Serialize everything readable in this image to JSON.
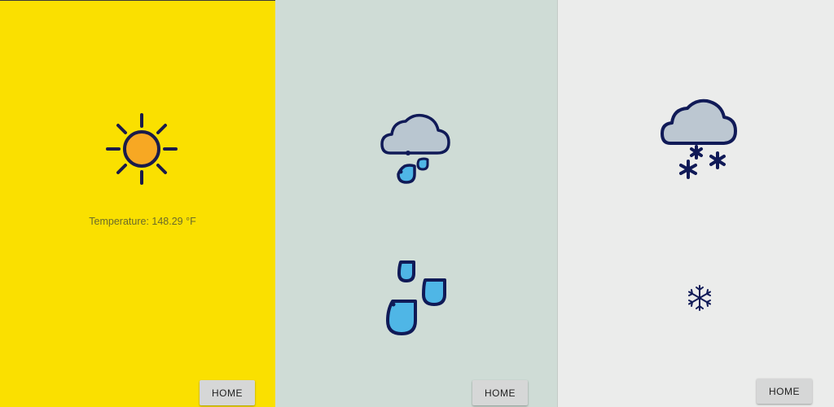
{
  "panels": {
    "sunny": {
      "background": "#fae000",
      "icon": "sun-icon",
      "temperature_text": "Temperature: 148.29 °F",
      "home_label": "HOME"
    },
    "rain": {
      "background": "#cfdcd6",
      "icons": [
        "cloud-rain-icon",
        "raindrops-icon"
      ],
      "home_label": "HOME"
    },
    "snow": {
      "background": "#ebeceb",
      "icons": [
        "cloud-snow-icon",
        "snowflake-icon"
      ],
      "home_label": "HOME"
    }
  }
}
